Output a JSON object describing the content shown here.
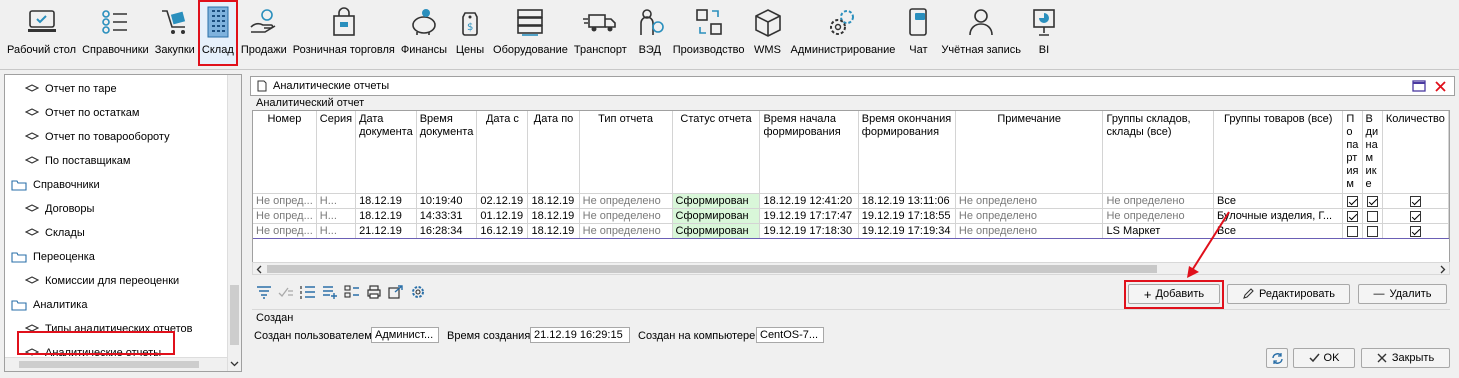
{
  "toolbar": {
    "items": [
      {
        "label": "Рабочий стол",
        "icon": "desktop-icon"
      },
      {
        "label": "Справочники",
        "icon": "list-icon"
      },
      {
        "label": "Закупки",
        "icon": "cart-icon"
      },
      {
        "label": "Склад",
        "icon": "warehouse-icon"
      },
      {
        "label": "Продажи",
        "icon": "hand-coin-icon"
      },
      {
        "label": "Розничная торговля",
        "icon": "shopping-bag-icon"
      },
      {
        "label": "Финансы",
        "icon": "piggy-bank-icon"
      },
      {
        "label": "Цены",
        "icon": "price-tag-icon"
      },
      {
        "label": "Оборудование",
        "icon": "server-rack-icon"
      },
      {
        "label": "Транспорт",
        "icon": "truck-icon"
      },
      {
        "label": "ВЭД",
        "icon": "person-globe-icon"
      },
      {
        "label": "Производство",
        "icon": "production-icon"
      },
      {
        "label": "WMS",
        "icon": "box-icon"
      },
      {
        "label": "Администрирование",
        "icon": "gears-icon"
      },
      {
        "label": "Чат",
        "icon": "chat-phone-icon"
      },
      {
        "label": "Учётная запись",
        "icon": "user-icon"
      },
      {
        "label": "BI",
        "icon": "bi-chart-icon"
      }
    ]
  },
  "sidebar": {
    "items": [
      {
        "label": "Отчет по таре"
      },
      {
        "label": "Отчет по остаткам"
      },
      {
        "label": "Отчет по товарообороту"
      },
      {
        "label": "По поставщикам"
      },
      {
        "label": "Справочники"
      },
      {
        "label": "Договоры"
      },
      {
        "label": "Склады"
      },
      {
        "label": "Переоценка"
      },
      {
        "label": "Комиссии для переоценки"
      },
      {
        "label": "Аналитика"
      },
      {
        "label": "Типы аналитических отчетов"
      },
      {
        "label": "Аналитические отчеты"
      }
    ]
  },
  "panel": {
    "title": "Аналитические отчеты",
    "group_label": "Аналитический отчет"
  },
  "grid": {
    "headers": [
      "Номер",
      "Серия",
      "Дата документа",
      "Время документа",
      "Дата с",
      "Дата по",
      "Тип отчета",
      "Статус отчета",
      "Время начала формирования",
      "Время окончания формирования",
      "Примечание",
      "Группы складов, склады (все)",
      "Группы товаров (все)",
      "По партиям",
      "В динамике",
      "Количество"
    ],
    "rows": [
      {
        "num": "Не опред...",
        "ser": "Н...",
        "date": "18.12.19",
        "time": "10:19:40",
        "from": "02.12.19",
        "to": "18.12.19",
        "type": "Не определено",
        "status": "Сформирован",
        "start": "18.12.19 12:41:20",
        "end": "18.12.19 13:11:06",
        "note": "Не определено",
        "stores": "Не определено",
        "goods": "Все",
        "p": true,
        "d": true,
        "q": true
      },
      {
        "num": "Не опред...",
        "ser": "Н...",
        "date": "18.12.19",
        "time": "14:33:31",
        "from": "01.12.19",
        "to": "18.12.19",
        "type": "Не определено",
        "status": "Сформирован",
        "start": "19.12.19 17:17:47",
        "end": "19.12.19 17:18:55",
        "note": "Не определено",
        "stores": "Не определено",
        "goods": "Булочные изделия, Г...",
        "p": true,
        "d": false,
        "q": true
      },
      {
        "num": "Не опред...",
        "ser": "Н...",
        "date": "21.12.19",
        "time": "16:28:34",
        "from": "16.12.19",
        "to": "18.12.19",
        "type": "Не определено",
        "status": "Сформирован",
        "start": "19.12.19 17:18:30",
        "end": "19.12.19 17:19:34",
        "note": "Не определено",
        "stores": "LS Маркет",
        "goods": "Все",
        "p": false,
        "d": false,
        "q": true
      }
    ]
  },
  "buttons": {
    "add": "Добавить",
    "edit": "Редактировать",
    "delete": "Удалить",
    "ok": "OK",
    "close": "Закрыть"
  },
  "created": {
    "section": "Создан",
    "user_label": "Создан пользователем",
    "user_value": "Админист...",
    "time_label": "Время создания",
    "time_value": "21.12.19 16:29:15",
    "host_label": "Создан на компьютере",
    "host_value": "CentOS-7..."
  },
  "colors": {
    "highlight": "#e0101b",
    "status_bg": "#d9f7d9",
    "icon_blue": "#2a8fbd"
  }
}
